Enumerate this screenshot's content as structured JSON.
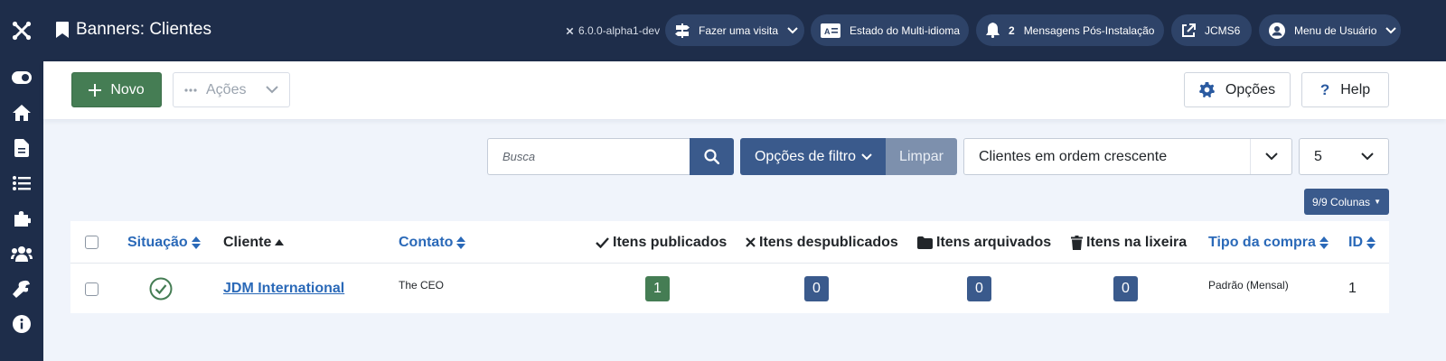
{
  "header": {
    "title": "Banners: Clientes",
    "version": "6.0.0-alpha1-dev",
    "tour_label": "Fazer uma visita",
    "multilang_label": "Estado do Multi-idioma",
    "notifications_count": "2",
    "postinstall_label": "Mensagens Pós-Instalação",
    "site_label": "JCMS6",
    "user_menu_label": "Menu de Usuário"
  },
  "toolbar": {
    "new_label": "Novo",
    "actions_label": "Ações",
    "options_label": "Opções",
    "help_label": "Help"
  },
  "filters": {
    "search_placeholder": "Busca",
    "filter_options_label": "Opções de filtro",
    "clear_label": "Limpar",
    "sort_value": "Clientes em ordem crescente",
    "limit_value": "5",
    "columns_label": "9/9 Colunas"
  },
  "table": {
    "headers": {
      "status": "Situação",
      "client": "Cliente",
      "contact": "Contato",
      "published": "Itens publicados",
      "unpublished": "Itens despublicados",
      "archived": "Itens arquivados",
      "trashed": "Itens na lixeira",
      "purchase_type": "Tipo da compra",
      "id": "ID"
    },
    "rows": [
      {
        "client": "JDM International",
        "contact": "The CEO",
        "published": "1",
        "unpublished": "0",
        "archived": "0",
        "trashed": "0",
        "purchase_type": "Padrão (Mensal)",
        "id": "1"
      }
    ]
  },
  "colors": {
    "sidebar_bg": "#1e2d4a",
    "primary": "#3a5a8c",
    "success": "#457d54",
    "link": "#2a69b8"
  }
}
